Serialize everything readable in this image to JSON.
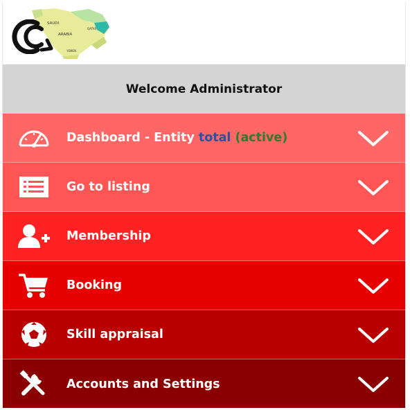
{
  "header": {
    "logo_icon": "cc-logo-icon",
    "map_image": "middle-east-map-image",
    "map_labels": [
      "SAUDI",
      "ARABIA",
      "QATAR",
      "YEMEN"
    ]
  },
  "welcome": {
    "text": "Welcome Administrator"
  },
  "menu": [
    {
      "label": "Dashboard - Entity",
      "extra_blue": "total",
      "extra_green": "(active)",
      "icon": "speedometer-icon",
      "bg": "#ff6666"
    },
    {
      "label": "Go to listing",
      "icon": "list-icon",
      "bg": "#ff5555"
    },
    {
      "label": "Membership",
      "icon": "add-user-icon",
      "bg": "#ff2222"
    },
    {
      "label": "Booking",
      "icon": "shopping-cart-icon",
      "bg": "#e60000"
    },
    {
      "label": "Skill appraisal",
      "icon": "soccer-ball-icon",
      "bg": "#b80000"
    },
    {
      "label": "Accounts and Settings",
      "icon": "tools-icon",
      "bg": "#8a0000"
    }
  ],
  "colors": {
    "welcome_bg": "#d4d4d4",
    "icon": "#ffffff",
    "chevron": "#ffffff"
  }
}
